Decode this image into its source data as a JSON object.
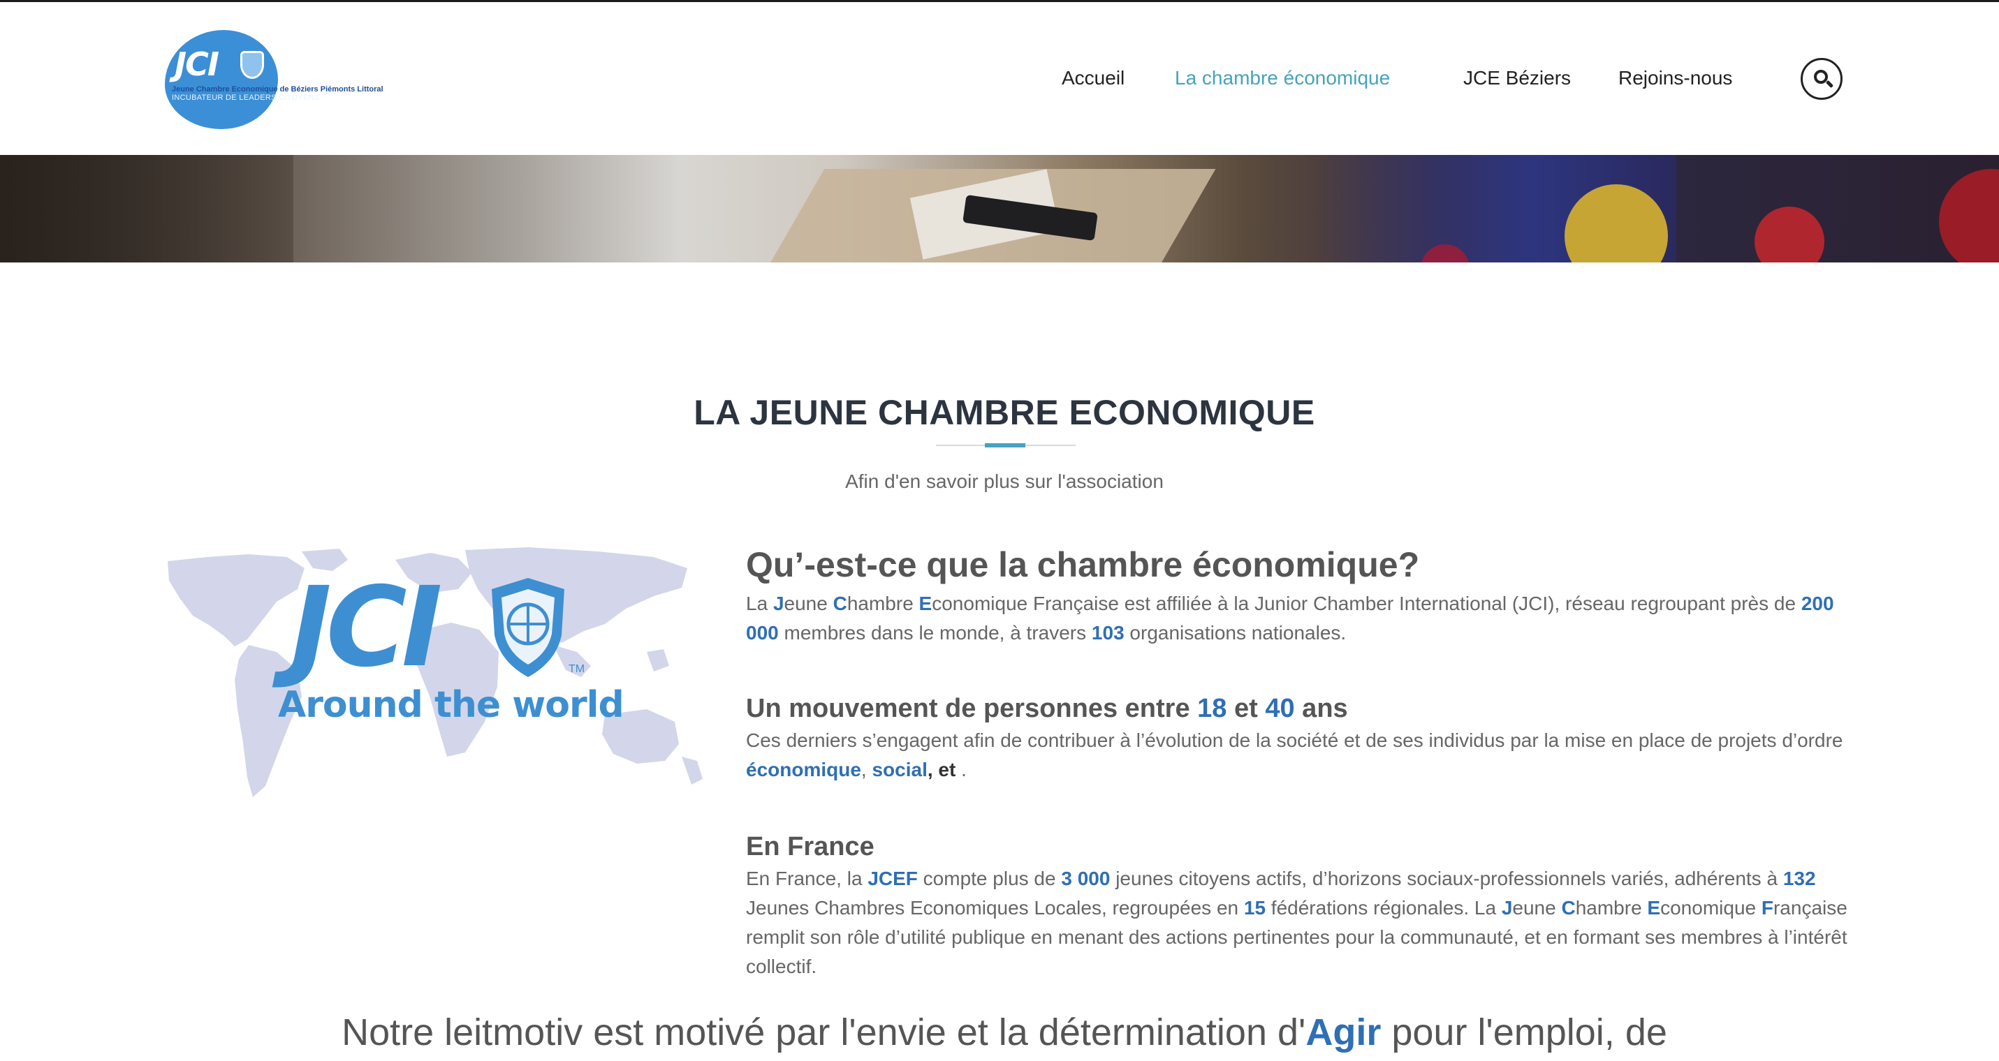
{
  "header": {
    "logo": {
      "mark": "JCI",
      "line1": "Jeune Chambre Economique de Béziers Piémonts Littoral",
      "line2": "INCUBATEUR DE LEADERS CITOYENS"
    },
    "nav": [
      {
        "label": "Accueil",
        "active": false
      },
      {
        "label": "La chambre économique",
        "active": true
      },
      {
        "label": "JCE Béziers",
        "active": false
      },
      {
        "label": "Rejoins-nous",
        "active": false
      }
    ],
    "search_icon": "search-icon"
  },
  "section": {
    "title": "LA JEUNE CHAMBRE ECONOMIQUE",
    "subtitle": "Afin d'en savoir plus sur l'association"
  },
  "illustration": {
    "mark": "JCI",
    "tm": "TM",
    "tagline": "Around the world"
  },
  "blocks": {
    "b1": {
      "title": "Qu’-est-ce que la chambre économique?",
      "l_la": "La ",
      "J": "J",
      "eune": "eune ",
      "C": "C",
      "hambre": "hambre ",
      "E": "E",
      "rest1": "conomique Française est affiliée à la Junior Chamber International (JCI), réseau regroupant près de ",
      "n1": "200 000",
      "rest2": " membres dans le monde, à travers ",
      "n2": "103",
      "rest3": " organisations nationales."
    },
    "b2": {
      "title_a": "Un mouvement de personnes entre ",
      "n1": "18",
      "title_b": " et ",
      "n2": "40",
      "title_c": " ans",
      "text_a": "Ces derniers s’engagent afin de contribuer à l’évolution de la société et de ses individus par la mise en place de projets d’ordre ",
      "w1": "économique",
      "comma": ", ",
      "w2": "social",
      "et": ", et",
      "end": " ."
    },
    "b3": {
      "title": "En France",
      "t1": "En France, la ",
      "jcef": "JCEF",
      "t2": " compte plus de ",
      "n1": "3 000",
      "t3": " jeunes citoyens actifs, d’horizons sociaux-professionnels variés, adhérents à ",
      "n2": "132",
      "t4": " Jeunes Chambres Economiques Locales, regroupées en ",
      "n3": "15",
      "t5": " fédérations régionales. La ",
      "J": "J",
      "t6": "eune ",
      "C": "C",
      "t7": "hambre ",
      "E": "E",
      "t8": "conomique ",
      "F": "F",
      "t9": "rançaise remplit son rôle d’utilité publique en menant des actions pertinentes pour la communauté, et en formant ses membres à l’intérêt collectif."
    }
  },
  "leitmotiv": {
    "a": "Notre leitmotiv est motivé par l'envie et la détermination d'",
    "agir": "Agir",
    "b": " pour l'emploi, de"
  },
  "colors": {
    "accent": "#45a3bf",
    "highlight": "#2f6fb4",
    "brand_blue": "#3b8fd6"
  }
}
